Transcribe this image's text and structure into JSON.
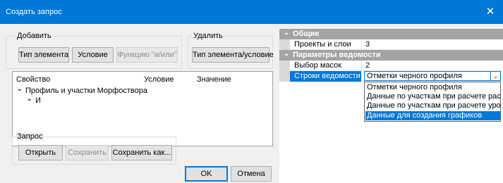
{
  "window": {
    "title": "Создать запрос",
    "close_glyph": "✕"
  },
  "add_group": {
    "label": "Добавить",
    "element_type": "Тип элемента",
    "condition": "Условие",
    "function": "Функцию \"и/или\""
  },
  "remove_group": {
    "label": "Удалить",
    "element_condition": "Тип элемента/условие"
  },
  "tree": {
    "columns": [
      "Свойство",
      "Условие",
      "Значение"
    ],
    "nodes": [
      {
        "label": "Профиль и участки Морфоствора",
        "expanded": true
      },
      {
        "label": "И",
        "expanded": true
      }
    ],
    "chevron_glyph": "⌄"
  },
  "query_group": {
    "label": "Запрос",
    "open": "Открыть",
    "save": "Сохранить",
    "save_as": "Сохранить как..."
  },
  "dialog": {
    "ok": "OK",
    "cancel": "Отмена"
  },
  "property_grid": {
    "categories": [
      {
        "name": "Общие",
        "rows": [
          {
            "name": "Проекты и слои",
            "value": "3"
          }
        ]
      },
      {
        "name": "Параметры ведомости",
        "rows": [
          {
            "name": "Выбор масок",
            "value": "2"
          },
          {
            "name": "Строки ведомости",
            "value": "Отметки черного профиля"
          }
        ]
      }
    ],
    "expand_glyph": "⌄",
    "dropdown_arrow": "⌄",
    "dropdown_options": [
      "Отметки черного профиля",
      "Данные по участкам при расчете расхода",
      "Данные по участкам при расчете уровня",
      "Данные для создания графиков"
    ],
    "highlighted_option_index": 3
  }
}
